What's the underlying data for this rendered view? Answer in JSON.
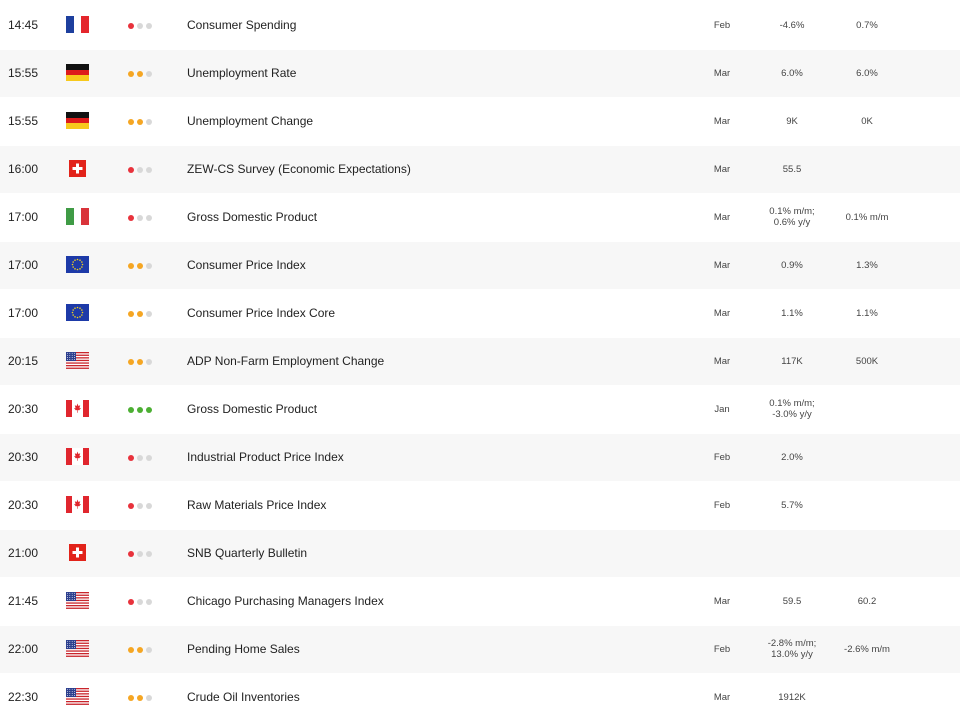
{
  "importance_colors": {
    "low": "#e8323c",
    "medium": "#f5a623",
    "high": "#4caf33",
    "off": "#d8d8d8"
  },
  "events": [
    {
      "time": "14:45",
      "flag": "fr-flag-icon",
      "importance": "low",
      "event": "Consumer Spending",
      "period": "Feb",
      "actual": "-4.6%",
      "forecast": "0.7%"
    },
    {
      "time": "15:55",
      "flag": "de-flag-icon",
      "importance": "medium",
      "event": "Unemployment Rate",
      "period": "Mar",
      "actual": "6.0%",
      "forecast": "6.0%"
    },
    {
      "time": "15:55",
      "flag": "de-flag-icon",
      "importance": "medium",
      "event": "Unemployment Change",
      "period": "Mar",
      "actual": "9K",
      "forecast": "0K"
    },
    {
      "time": "16:00",
      "flag": "ch-flag-icon",
      "importance": "low",
      "event": "ZEW-CS Survey (Economic Expectations)",
      "period": "Mar",
      "actual": "55.5",
      "forecast": ""
    },
    {
      "time": "17:00",
      "flag": "it-flag-icon",
      "importance": "low",
      "event": "Gross Domestic Product",
      "period": "Mar",
      "actual": "0.1% m/m;\n0.6% y/y",
      "forecast": "0.1% m/m"
    },
    {
      "time": "17:00",
      "flag": "eu-flag-icon",
      "importance": "medium",
      "event": "Consumer Price Index",
      "period": "Mar",
      "actual": "0.9%",
      "forecast": "1.3%"
    },
    {
      "time": "17:00",
      "flag": "eu-flag-icon",
      "importance": "medium",
      "event": "Consumer Price Index Core",
      "period": "Mar",
      "actual": "1.1%",
      "forecast": "1.1%"
    },
    {
      "time": "20:15",
      "flag": "us-flag-icon",
      "importance": "medium",
      "event": "ADP Non-Farm Employment Change",
      "period": "Mar",
      "actual": "117K",
      "forecast": "500K"
    },
    {
      "time": "20:30",
      "flag": "ca-flag-icon",
      "importance": "high",
      "event": "Gross Domestic Product",
      "period": "Jan",
      "actual": "0.1% m/m;\n-3.0% y/y",
      "forecast": ""
    },
    {
      "time": "20:30",
      "flag": "ca-flag-icon",
      "importance": "low",
      "event": "Industrial Product Price Index",
      "period": "Feb",
      "actual": "2.0%",
      "forecast": ""
    },
    {
      "time": "20:30",
      "flag": "ca-flag-icon",
      "importance": "low",
      "event": "Raw Materials Price Index",
      "period": "Feb",
      "actual": "5.7%",
      "forecast": ""
    },
    {
      "time": "21:00",
      "flag": "ch-flag-icon",
      "importance": "low",
      "event": "SNB Quarterly Bulletin",
      "period": "",
      "actual": "",
      "forecast": ""
    },
    {
      "time": "21:45",
      "flag": "us-flag-icon",
      "importance": "low",
      "event": "Chicago Purchasing Managers Index",
      "period": "Mar",
      "actual": "59.5",
      "forecast": "60.2"
    },
    {
      "time": "22:00",
      "flag": "us-flag-icon",
      "importance": "medium",
      "event": "Pending Home Sales",
      "period": "Feb",
      "actual": "-2.8% m/m;\n13.0% y/y",
      "forecast": "-2.6% m/m"
    },
    {
      "time": "22:30",
      "flag": "us-flag-icon",
      "importance": "medium",
      "event": "Crude Oil Inventories",
      "period": "Mar",
      "actual": "1912K",
      "forecast": ""
    }
  ]
}
